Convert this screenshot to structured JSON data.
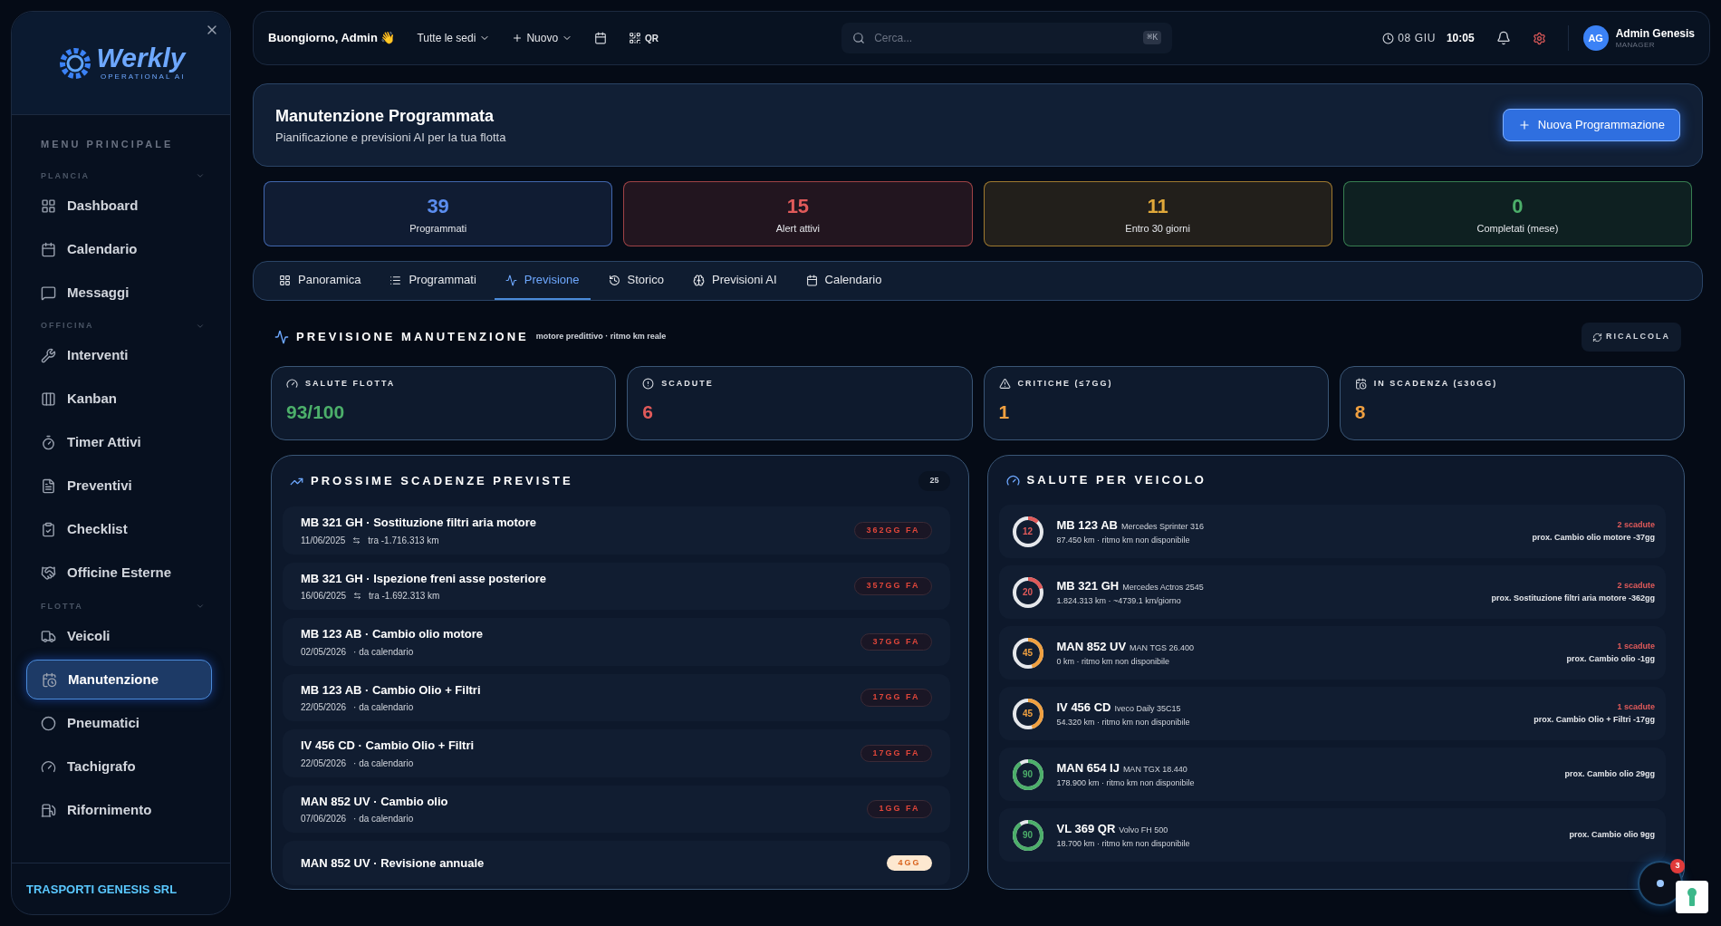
{
  "sidebar": {
    "logo": {
      "name": "Werkly",
      "tagline": "OPERATIONAL AI"
    },
    "heading": "MENU PRINCIPALE",
    "groups": [
      {
        "label": "PLANCIA",
        "expanded": true,
        "items": [
          {
            "label": "Dashboard",
            "selected": false
          },
          {
            "label": "Calendario",
            "selected": false
          },
          {
            "label": "Messaggi",
            "selected": false
          }
        ]
      },
      {
        "label": "OFFICINA",
        "expanded": true,
        "items": [
          {
            "label": "Interventi",
            "selected": false
          },
          {
            "label": "Kanban",
            "selected": false
          },
          {
            "label": "Timer Attivi",
            "selected": false
          },
          {
            "label": "Preventivi",
            "selected": false
          },
          {
            "label": "Checklist",
            "selected": false
          },
          {
            "label": "Officine Esterne",
            "selected": false
          }
        ]
      },
      {
        "label": "FLOTTA",
        "expanded": true,
        "items": [
          {
            "label": "Veicoli",
            "selected": false
          },
          {
            "label": "Manutenzione",
            "selected": true
          },
          {
            "label": "Pneumatici",
            "selected": false
          },
          {
            "label": "Tachigrafo",
            "selected": false
          },
          {
            "label": "Rifornimento",
            "selected": false
          }
        ]
      }
    ],
    "company": "TRASPORTI GENESIS SRL"
  },
  "topbar": {
    "greeting": "Buongiorno, Admin 👋",
    "site_filter": "Tutte le sedi",
    "new_button": "Nuovo",
    "qr": "QR",
    "search": {
      "placeholder": "Cerca...",
      "shortcut": "⌘K"
    },
    "date": "08 GIU",
    "time": "10:05",
    "user": {
      "initials": "AG",
      "name": "Admin Genesis",
      "role": "MANAGER"
    }
  },
  "header": {
    "title": "Manutenzione Programmata",
    "subtitle": "Pianificazione e previsioni AI per la tua flotta",
    "action": "Nuova Programmazione"
  },
  "stats": [
    {
      "value": "39",
      "label": "Programmati",
      "color": "#5b8def"
    },
    {
      "value": "15",
      "label": "Alert attivi",
      "color": "#e05a5a"
    },
    {
      "value": "11",
      "label": "Entro 30 giorni",
      "color": "#e0a83a"
    },
    {
      "value": "0",
      "label": "Completati (mese)",
      "color": "#4caf6a"
    }
  ],
  "tabs": [
    {
      "label": "Panoramica",
      "selected": false
    },
    {
      "label": "Programmati",
      "selected": false
    },
    {
      "label": "Previsione",
      "selected": true
    },
    {
      "label": "Storico",
      "selected": false
    },
    {
      "label": "Previsioni AI",
      "selected": false
    },
    {
      "label": "Calendario",
      "selected": false
    }
  ],
  "forecast": {
    "title": "PREVISIONE MANUTENZIONE",
    "subtitle": "motore predittivo · ritmo km reale",
    "recalc": "RICALCOLA",
    "metrics": [
      {
        "label": "SALUTE FLOTTA",
        "value": "93/100",
        "color": "#4caf6a"
      },
      {
        "label": "SCADUTE",
        "value": "6",
        "color": "#e05a5a"
      },
      {
        "label": "CRITICHE (≤7GG)",
        "value": "1",
        "color": "#f0a040"
      },
      {
        "label": "IN SCADENZA (≤30GG)",
        "value": "8",
        "color": "#f0a040"
      }
    ],
    "deadlines": {
      "title": "PROSSIME SCADENZE PREVISTE",
      "count": "25",
      "items": [
        {
          "title": "MB 321 GH · Sostituzione filtri aria motore",
          "date": "11/06/2025",
          "km_icon": true,
          "detail": "tra -1.716.313 km",
          "badge": "362GG FA",
          "kind": "overdue"
        },
        {
          "title": "MB 321 GH · Ispezione freni asse posteriore",
          "date": "16/06/2025",
          "km_icon": true,
          "detail": "tra -1.692.313 km",
          "badge": "357GG FA",
          "kind": "overdue"
        },
        {
          "title": "MB 123 AB · Cambio olio motore",
          "date": "02/05/2026",
          "km_icon": false,
          "detail": "· da calendario",
          "badge": "37GG FA",
          "kind": "overdue"
        },
        {
          "title": "MB 123 AB · Cambio Olio + Filtri",
          "date": "22/05/2026",
          "km_icon": false,
          "detail": "· da calendario",
          "badge": "17GG FA",
          "kind": "overdue"
        },
        {
          "title": "IV 456 CD · Cambio Olio + Filtri",
          "date": "22/05/2026",
          "km_icon": false,
          "detail": "· da calendario",
          "badge": "17GG FA",
          "kind": "overdue"
        },
        {
          "title": "MAN 852 UV · Cambio olio",
          "date": "07/06/2026",
          "km_icon": false,
          "detail": "· da calendario",
          "badge": "1GG FA",
          "kind": "overdue"
        },
        {
          "title": "MAN 852 UV · Revisione annuale",
          "badge": "4GG",
          "kind": "upcoming"
        }
      ]
    },
    "vehicles": {
      "title": "SALUTE PER VEICOLO",
      "items": [
        {
          "score": "12",
          "color": "#e05a5a",
          "plate": "MB 123 AB",
          "model": "Mercedes Sprinter 316",
          "detail": "87.450 km · ritmo km non disponibile",
          "overdue": "2 scadute",
          "next": "prox. Cambio olio motore -37gg"
        },
        {
          "score": "20",
          "color": "#e05a5a",
          "plate": "MB 321 GH",
          "model": "Mercedes Actros 2545",
          "detail": "1.824.313 km · ~4739.1 km/giorno",
          "overdue": "2 scadute",
          "next": "prox. Sostituzione filtri aria motore -362gg"
        },
        {
          "score": "45",
          "color": "#f0a040",
          "plate": "MAN 852 UV",
          "model": "MAN TGS 26.400",
          "detail": "0 km · ritmo km non disponibile",
          "overdue": "1 scadute",
          "next": "prox. Cambio olio -1gg"
        },
        {
          "score": "45",
          "color": "#f0a040",
          "plate": "IV 456 CD",
          "model": "Iveco Daily 35C15",
          "detail": "54.320 km · ritmo km non disponibile",
          "overdue": "1 scadute",
          "next": "prox. Cambio Olio + Filtri -17gg"
        },
        {
          "score": "90",
          "color": "#4caf6a",
          "plate": "MAN 654 IJ",
          "model": "MAN TGX 18.440",
          "detail": "178.900 km · ritmo km non disponibile",
          "next": "prox. Cambio olio 29gg"
        },
        {
          "score": "90",
          "color": "#4caf6a",
          "plate": "VL 369 QR",
          "model": "Volvo FH 500",
          "detail": "18.700 km · ritmo km non disponibile",
          "next": "prox. Cambio olio 9gg"
        }
      ]
    }
  },
  "assistant": {
    "badge": "3"
  }
}
